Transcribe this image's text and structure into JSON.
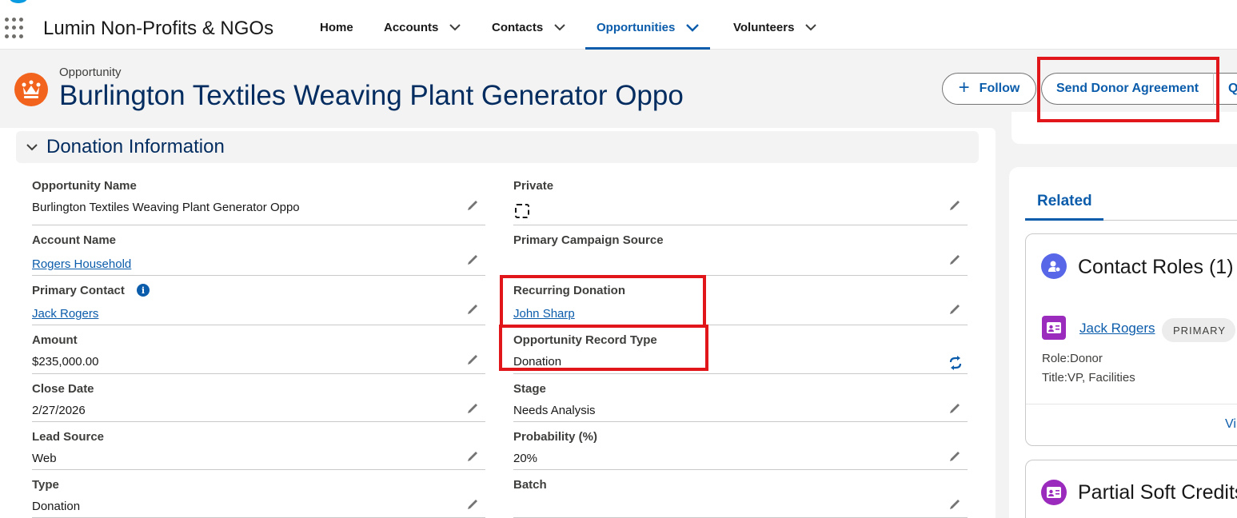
{
  "nav": {
    "app_name": "Lumin Non-Profits & NGOs",
    "items": [
      {
        "label": "Home"
      },
      {
        "label": "Accounts"
      },
      {
        "label": "Contacts"
      },
      {
        "label": "Opportunities"
      },
      {
        "label": "Volunteers"
      }
    ],
    "active": "Opportunities"
  },
  "header": {
    "record_type": "Opportunity",
    "title": "Burlington Textiles Weaving Plant Generator Oppo",
    "follow_label": "Follow",
    "send_label": "Send Donor Agreement",
    "more_label": "Q"
  },
  "section": {
    "title": "Donation Information"
  },
  "fields": {
    "opportunity_name": {
      "label": "Opportunity Name",
      "value": "Burlington Textiles Weaving Plant Generator Oppo"
    },
    "private": {
      "label": "Private",
      "checked": false
    },
    "account_name": {
      "label": "Account Name",
      "value": "Rogers Household"
    },
    "primary_campaign_source": {
      "label": "Primary Campaign Source",
      "value": ""
    },
    "primary_contact": {
      "label": "Primary Contact",
      "value": "Jack Rogers",
      "info": "i"
    },
    "recurring_donation": {
      "label": "Recurring Donation",
      "value": "John Sharp"
    },
    "amount": {
      "label": "Amount",
      "value": "$235,000.00"
    },
    "record_type": {
      "label": "Opportunity Record Type",
      "value": "Donation"
    },
    "close_date": {
      "label": "Close Date",
      "value": "2/27/2026"
    },
    "stage": {
      "label": "Stage",
      "value": "Needs Analysis"
    },
    "lead_source": {
      "label": "Lead Source",
      "value": "Web"
    },
    "probability": {
      "label": "Probability (%)",
      "value": "20%"
    },
    "type": {
      "label": "Type",
      "value": "Donation"
    },
    "batch": {
      "label": "Batch",
      "value": ""
    }
  },
  "related": {
    "tab_label": "Related",
    "contact_roles": {
      "title": "Contact Roles (1)",
      "contact_name": "Jack Rogers",
      "badge": "PRIMARY",
      "role_line": "Role:Donor",
      "title_line": "Title:VP, Facilities",
      "view_all": "Vi"
    },
    "soft_credits": {
      "title": "Partial Soft Credits"
    }
  },
  "colors": {
    "brand": "#0b5cab",
    "title": "#032d60",
    "record_icon": "#f2641e",
    "highlight": "#e0161a",
    "contact_roles_icon": "#5867e8",
    "contact_icon": "#9b2bbd"
  },
  "icons": {
    "app_launcher": "waffle-icon",
    "record": "crown-icon",
    "edit": "pencil-icon",
    "record_type_change": "swap-icon"
  }
}
